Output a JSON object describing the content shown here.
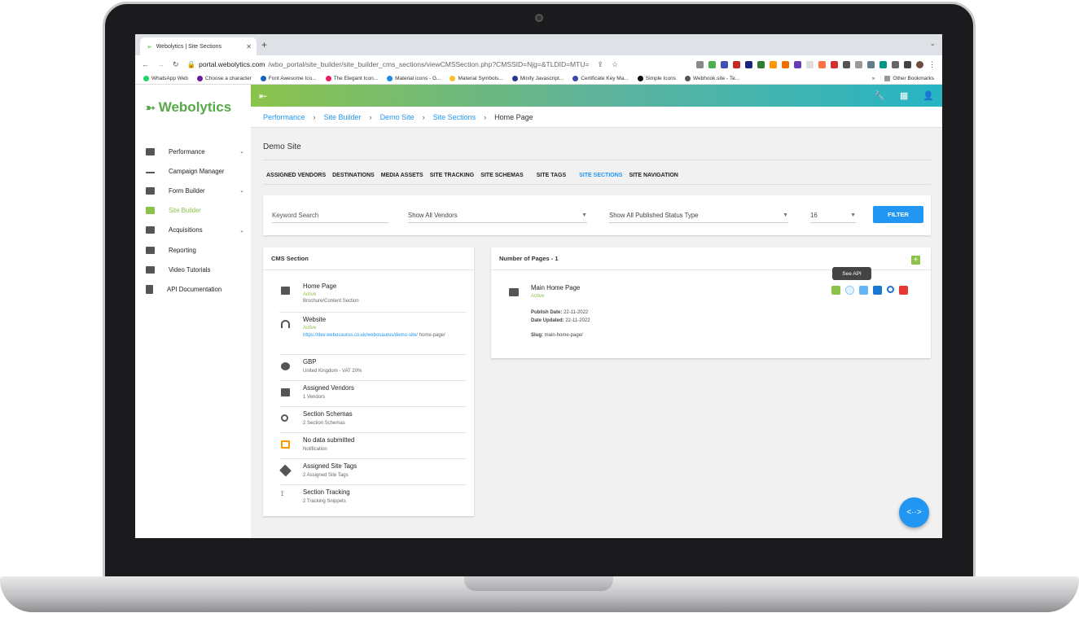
{
  "browser": {
    "tab_title": "Webolytics | Site Sections",
    "new_tab": "+",
    "url_host": "portal.webolytics.com",
    "url_path": "/wbo_portal/site_builder/site_builder_cms_sections/viewCMSSection.php?CMSSID=Njg=&TLDID=MTU=",
    "bookmarks": [
      "WhatsApp Web",
      "Choose a character",
      "Font Awesome Ico...",
      "The Elegant Icon...",
      "Material icons - G...",
      "Material Symbols...",
      "Minify Javascript...",
      "Certificate Key Ma...",
      "Simple Icons",
      "Webhook.site - Te..."
    ],
    "bookmarks_more": "»",
    "other_bookmarks": "Other Bookmarks"
  },
  "app": {
    "logo_text": "Webolytics",
    "nav": [
      {
        "label": "Performance",
        "chev": true
      },
      {
        "label": "Campaign Manager",
        "chev": false
      },
      {
        "label": "Form Builder",
        "chev": true
      },
      {
        "label": "Site Builder",
        "chev": false,
        "active": true
      },
      {
        "label": "Acquisitions",
        "chev": true
      },
      {
        "label": "Reporting",
        "chev": false
      },
      {
        "label": "Video Tutorials",
        "chev": false
      },
      {
        "label": "API Documentation",
        "chev": false
      }
    ],
    "breadcrumb": [
      "Performance",
      "Site Builder",
      "Demo Site",
      "Site Sections",
      "Home Page"
    ],
    "page_title": "Demo Site",
    "tabs": [
      "ASSIGNED VENDORS",
      "DESTINATIONS",
      "MEDIA ASSETS",
      "SITE TRACKING",
      "SITE SCHEMAS",
      "SITE TAGS",
      "SITE SECTIONS",
      "SITE NAVIGATION"
    ],
    "active_tab": "SITE SECTIONS",
    "filter": {
      "keyword_placeholder": "Keyword Search",
      "vendors": "Show All Vendors",
      "status": "Show All Published Status Type",
      "count": "16",
      "button": "FILTER"
    },
    "cms_card": {
      "title": "CMS Section",
      "items": [
        {
          "title": "Home Page",
          "status": "Active",
          "sub": "Brochure/Content Section"
        },
        {
          "title": "Website",
          "status": "Active",
          "link": "https://dev.webosaurus.co.uk/webosaurus/demo-site/",
          "link_rest": "home-page/"
        },
        {
          "title": "GBP",
          "sub": "United Kingdom - VAT 20%"
        },
        {
          "title": "Assigned Vendors",
          "sub": "1 Vendors"
        },
        {
          "title": "Section Schemas",
          "sub": "2 Section Schemas"
        },
        {
          "title": "No data submitted",
          "sub": "Notification"
        },
        {
          "title": "Assigned Site Tags",
          "sub": "2 Assigned Site Tags"
        },
        {
          "title": "Section Tracking",
          "sub": "2 Tracking Snippets"
        }
      ]
    },
    "pages_card": {
      "title": "Number of Pages - 1",
      "tooltip": "See API",
      "page": {
        "title": "Main Home Page",
        "status": "Active",
        "publish_label": "Publish Date:",
        "publish_date": "22-11-2022",
        "updated_label": "Date Updated:",
        "updated_date": "22-11-2022",
        "slug_label": "Slug:",
        "slug": "main-home-page/"
      }
    },
    "fab_label": "<··>"
  },
  "colors": {
    "accent_green": "#8bc34a",
    "accent_blue": "#2196f3",
    "delete_red": "#e53935"
  }
}
